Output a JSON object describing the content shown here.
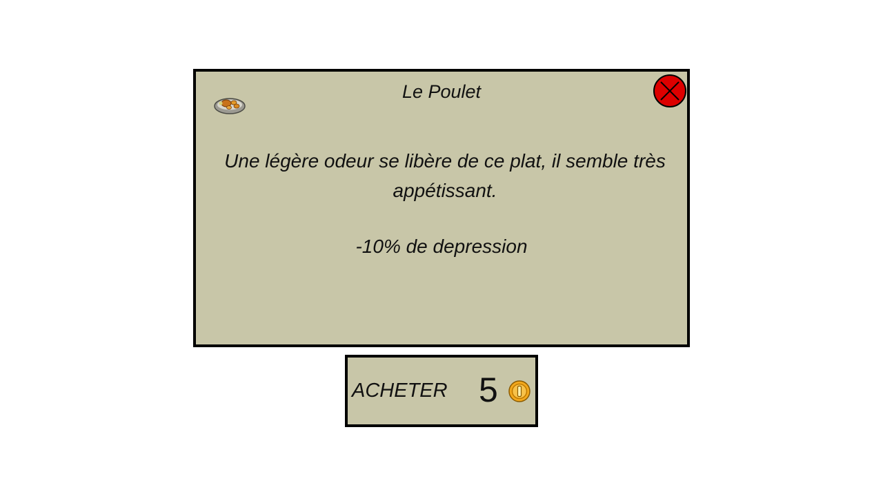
{
  "item": {
    "title": "Le Poulet",
    "description": "Une légère odeur se libère de ce plat, il semble très appétissant.",
    "effect": "-10% de depression",
    "icon": "roast-chicken-plate-icon"
  },
  "close": {
    "icon": "close-icon",
    "color": "#dd0000"
  },
  "buy": {
    "label": "ACHETER",
    "price": "5",
    "currency_icon": "gold-coin-icon"
  },
  "colors": {
    "panel": "#c8c6a8",
    "border": "#000000",
    "coin": "#f2a81d"
  }
}
